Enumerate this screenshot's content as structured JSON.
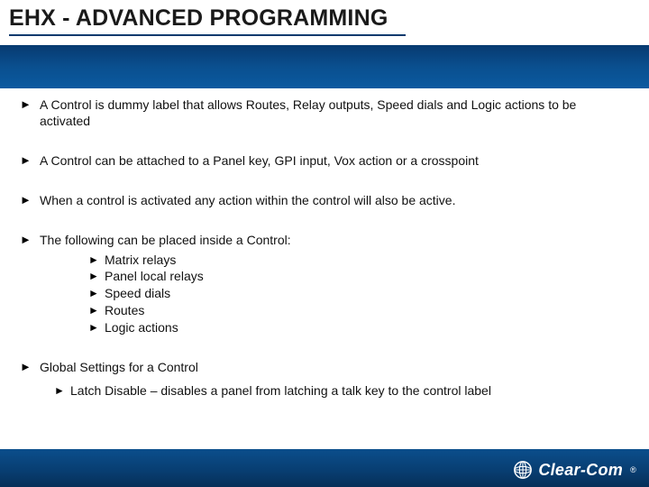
{
  "title": "EHX - ADVANCED PROGRAMMING",
  "bullets": {
    "b1": "A Control is dummy label that allows Routes, Relay outputs, Speed dials and Logic actions to be activated",
    "b2": "A Control can be attached to a Panel key, GPI input, Vox action or a crosspoint",
    "b3": "When a control is activated any action within the control will also be active.",
    "b4": "The following can be placed inside a Control:",
    "b4_items": {
      "s1": "Matrix relays",
      "s2": "Panel local relays",
      "s3": "Speed dials",
      "s4": "Routes",
      "s5": "Logic actions"
    },
    "b5": "Global Settings for a Control",
    "b5_items": {
      "s1": "Latch Disable – disables a panel from latching a talk key to the control label"
    }
  },
  "brand": "Clear-Com",
  "reg": "®"
}
